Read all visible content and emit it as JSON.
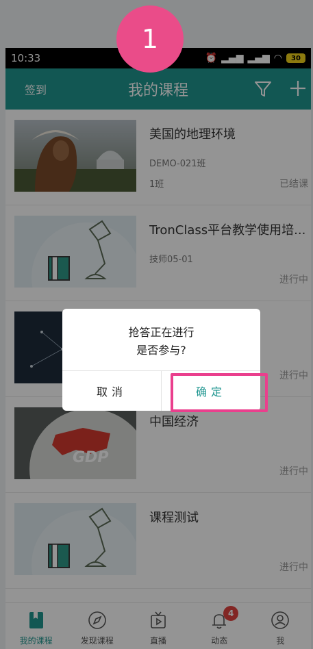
{
  "step_badge": "1",
  "status_bar": {
    "time": "10:33",
    "battery": "30",
    "alarm_icon": "alarm-icon",
    "signal_icon": "signal-icon",
    "wifi_icon": "wifi-icon"
  },
  "app_bar": {
    "left_button": "签到",
    "title": "我的课程",
    "filter_icon": "filter-icon",
    "add_icon": "add-icon"
  },
  "courses": [
    {
      "name": "美国的地理环境",
      "sub": "DEMO-021班",
      "sub2": "1班",
      "status": "已结课"
    },
    {
      "name": "TronClass平台教学使用培...",
      "sub": "技师05-01",
      "sub2": "",
      "status": "进行中"
    },
    {
      "name": "",
      "sub": "",
      "sub2": "",
      "status": "进行中"
    },
    {
      "name": "中国经济",
      "sub": "",
      "sub2": "",
      "status": "进行中",
      "thumb_text": "GDP"
    },
    {
      "name": "课程测试",
      "sub": "",
      "sub2": "",
      "status": "进行中"
    }
  ],
  "dialog": {
    "line1": "抢答正在进行",
    "line2": "是否参与?",
    "cancel": "取消",
    "confirm": "确定"
  },
  "tabs": [
    {
      "label": "我的课程",
      "icon": "book-icon",
      "active": true
    },
    {
      "label": "发现课程",
      "icon": "compass-icon"
    },
    {
      "label": "直播",
      "icon": "tv-icon"
    },
    {
      "label": "动态",
      "icon": "bell-icon",
      "badge": "4"
    },
    {
      "label": "我",
      "icon": "user-icon"
    }
  ],
  "colors": {
    "primary": "#1f9690",
    "highlight": "#ea3f8d",
    "badge": "#e0423f",
    "step_badge": "#ea4c89"
  }
}
